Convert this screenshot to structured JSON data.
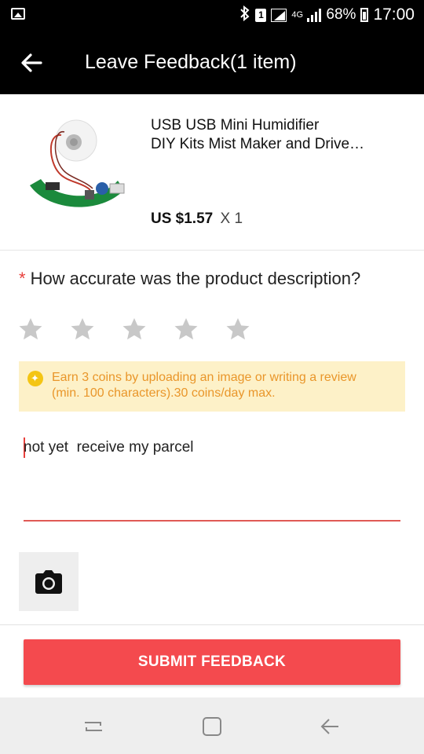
{
  "status_bar": {
    "bluetooth_icon": "bluetooth-icon",
    "sim_label": "1",
    "network_label": "4G",
    "battery_percent": "68%",
    "time": "17:00"
  },
  "app_bar": {
    "title": "Leave Feedback(1 item)",
    "back_icon": "back-arrow-icon"
  },
  "product": {
    "title_line1": "USB USB Mini Humidifier",
    "title_line2": "DIY Kits Mist Maker and Drive…",
    "price": "US $1.57",
    "quantity": "X 1"
  },
  "question": {
    "required_mark": "*",
    "text": "How accurate was the product description?"
  },
  "rating": {
    "max": 5,
    "value": 0
  },
  "tip": {
    "line1": "Earn 3 coins by uploading an image or writing a review",
    "line2": "(min. 100 characters).30 coins/day max."
  },
  "review": {
    "value": "not yet  receive my parcel"
  },
  "submit": {
    "label": "SUBMIT FEEDBACK"
  },
  "colors": {
    "accent": "#f44a4e",
    "tip_bg": "#fdf1c8",
    "tip_text": "#e9962a",
    "star_empty": "#c8c8c8"
  }
}
